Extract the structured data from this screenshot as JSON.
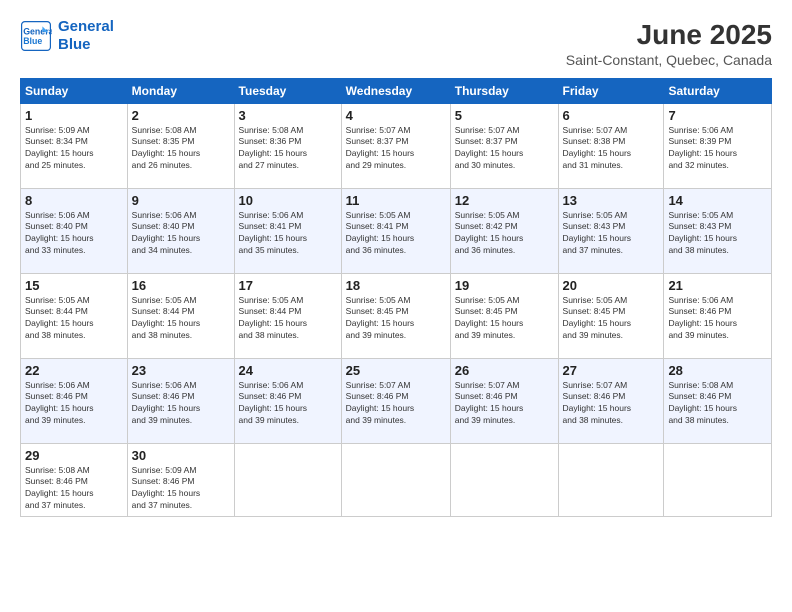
{
  "logo": {
    "line1": "General",
    "line2": "Blue"
  },
  "title": "June 2025",
  "subtitle": "Saint-Constant, Quebec, Canada",
  "headers": [
    "Sunday",
    "Monday",
    "Tuesday",
    "Wednesday",
    "Thursday",
    "Friday",
    "Saturday"
  ],
  "weeks": [
    [
      {
        "day": "1",
        "info": "Sunrise: 5:09 AM\nSunset: 8:34 PM\nDaylight: 15 hours\nand 25 minutes."
      },
      {
        "day": "2",
        "info": "Sunrise: 5:08 AM\nSunset: 8:35 PM\nDaylight: 15 hours\nand 26 minutes."
      },
      {
        "day": "3",
        "info": "Sunrise: 5:08 AM\nSunset: 8:36 PM\nDaylight: 15 hours\nand 27 minutes."
      },
      {
        "day": "4",
        "info": "Sunrise: 5:07 AM\nSunset: 8:37 PM\nDaylight: 15 hours\nand 29 minutes."
      },
      {
        "day": "5",
        "info": "Sunrise: 5:07 AM\nSunset: 8:37 PM\nDaylight: 15 hours\nand 30 minutes."
      },
      {
        "day": "6",
        "info": "Sunrise: 5:07 AM\nSunset: 8:38 PM\nDaylight: 15 hours\nand 31 minutes."
      },
      {
        "day": "7",
        "info": "Sunrise: 5:06 AM\nSunset: 8:39 PM\nDaylight: 15 hours\nand 32 minutes."
      }
    ],
    [
      {
        "day": "8",
        "info": "Sunrise: 5:06 AM\nSunset: 8:40 PM\nDaylight: 15 hours\nand 33 minutes."
      },
      {
        "day": "9",
        "info": "Sunrise: 5:06 AM\nSunset: 8:40 PM\nDaylight: 15 hours\nand 34 minutes."
      },
      {
        "day": "10",
        "info": "Sunrise: 5:06 AM\nSunset: 8:41 PM\nDaylight: 15 hours\nand 35 minutes."
      },
      {
        "day": "11",
        "info": "Sunrise: 5:05 AM\nSunset: 8:41 PM\nDaylight: 15 hours\nand 36 minutes."
      },
      {
        "day": "12",
        "info": "Sunrise: 5:05 AM\nSunset: 8:42 PM\nDaylight: 15 hours\nand 36 minutes."
      },
      {
        "day": "13",
        "info": "Sunrise: 5:05 AM\nSunset: 8:43 PM\nDaylight: 15 hours\nand 37 minutes."
      },
      {
        "day": "14",
        "info": "Sunrise: 5:05 AM\nSunset: 8:43 PM\nDaylight: 15 hours\nand 38 minutes."
      }
    ],
    [
      {
        "day": "15",
        "info": "Sunrise: 5:05 AM\nSunset: 8:44 PM\nDaylight: 15 hours\nand 38 minutes."
      },
      {
        "day": "16",
        "info": "Sunrise: 5:05 AM\nSunset: 8:44 PM\nDaylight: 15 hours\nand 38 minutes."
      },
      {
        "day": "17",
        "info": "Sunrise: 5:05 AM\nSunset: 8:44 PM\nDaylight: 15 hours\nand 38 minutes."
      },
      {
        "day": "18",
        "info": "Sunrise: 5:05 AM\nSunset: 8:45 PM\nDaylight: 15 hours\nand 39 minutes."
      },
      {
        "day": "19",
        "info": "Sunrise: 5:05 AM\nSunset: 8:45 PM\nDaylight: 15 hours\nand 39 minutes."
      },
      {
        "day": "20",
        "info": "Sunrise: 5:05 AM\nSunset: 8:45 PM\nDaylight: 15 hours\nand 39 minutes."
      },
      {
        "day": "21",
        "info": "Sunrise: 5:06 AM\nSunset: 8:46 PM\nDaylight: 15 hours\nand 39 minutes."
      }
    ],
    [
      {
        "day": "22",
        "info": "Sunrise: 5:06 AM\nSunset: 8:46 PM\nDaylight: 15 hours\nand 39 minutes."
      },
      {
        "day": "23",
        "info": "Sunrise: 5:06 AM\nSunset: 8:46 PM\nDaylight: 15 hours\nand 39 minutes."
      },
      {
        "day": "24",
        "info": "Sunrise: 5:06 AM\nSunset: 8:46 PM\nDaylight: 15 hours\nand 39 minutes."
      },
      {
        "day": "25",
        "info": "Sunrise: 5:07 AM\nSunset: 8:46 PM\nDaylight: 15 hours\nand 39 minutes."
      },
      {
        "day": "26",
        "info": "Sunrise: 5:07 AM\nSunset: 8:46 PM\nDaylight: 15 hours\nand 39 minutes."
      },
      {
        "day": "27",
        "info": "Sunrise: 5:07 AM\nSunset: 8:46 PM\nDaylight: 15 hours\nand 38 minutes."
      },
      {
        "day": "28",
        "info": "Sunrise: 5:08 AM\nSunset: 8:46 PM\nDaylight: 15 hours\nand 38 minutes."
      }
    ],
    [
      {
        "day": "29",
        "info": "Sunrise: 5:08 AM\nSunset: 8:46 PM\nDaylight: 15 hours\nand 37 minutes."
      },
      {
        "day": "30",
        "info": "Sunrise: 5:09 AM\nSunset: 8:46 PM\nDaylight: 15 hours\nand 37 minutes."
      },
      {
        "day": "",
        "info": ""
      },
      {
        "day": "",
        "info": ""
      },
      {
        "day": "",
        "info": ""
      },
      {
        "day": "",
        "info": ""
      },
      {
        "day": "",
        "info": ""
      }
    ]
  ]
}
